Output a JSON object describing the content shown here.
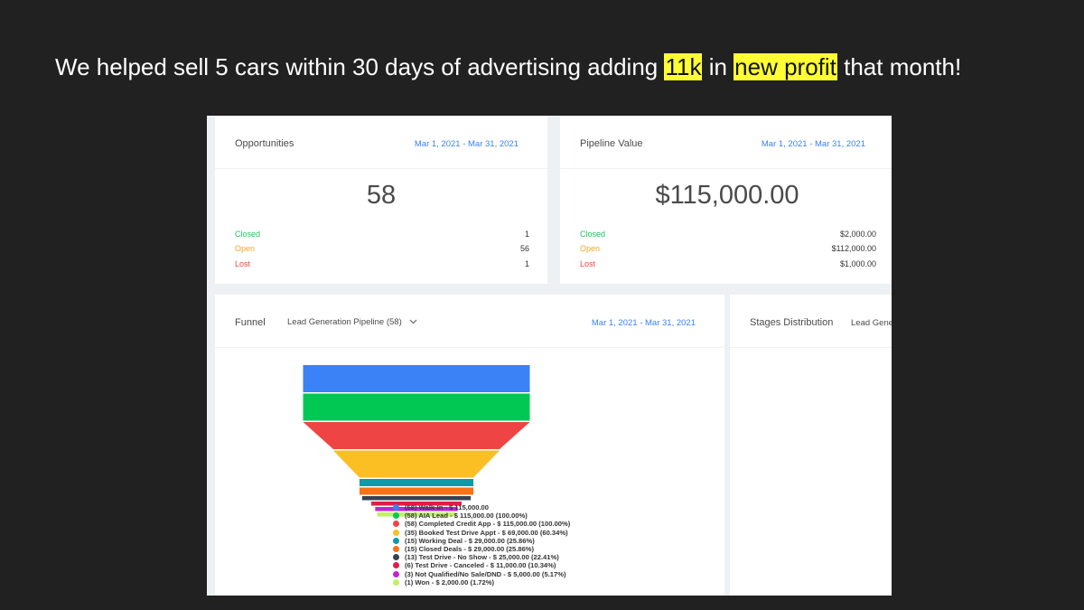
{
  "headline": {
    "part1": "We helped sell 5 cars within 30 days of advertising adding ",
    "highlight1": "11k",
    "part2": " in ",
    "highlight2": "new profit",
    "part3": " that month!"
  },
  "opportunities": {
    "title": "Opportunities",
    "date_range": "Mar 1, 2021 - Mar 31, 2021",
    "total": "58",
    "rows": [
      {
        "label": "Closed",
        "value": "1"
      },
      {
        "label": "Open",
        "value": "56"
      },
      {
        "label": "Lost",
        "value": "1"
      }
    ]
  },
  "pipeline_value": {
    "title": "Pipeline Value",
    "date_range": "Mar 1, 2021 - Mar 31, 2021",
    "total": "$115,000.00",
    "rows": [
      {
        "label": "Closed",
        "value": "$2,000.00"
      },
      {
        "label": "Open",
        "value": "$112,000.00"
      },
      {
        "label": "Lost",
        "value": "$1,000.00"
      }
    ]
  },
  "funnel": {
    "title": "Funnel",
    "pipeline_select": "Lead Generation Pipeline (58)",
    "date_range": "Mar 1, 2021 - Mar 31, 2021"
  },
  "stages": {
    "title": "Stages Distribution",
    "pipeline_select": "Lead Gene"
  },
  "chart_data": {
    "type": "funnel",
    "series": [
      {
        "name": "(58) Walk-In - $ 115,000.00",
        "value": 115000,
        "color": "#3b82f6"
      },
      {
        "name": "(58) AIA Lead - $ 115,000.00 (100.00%)",
        "value": 115000,
        "color": "#00c853"
      },
      {
        "name": "(58) Completed Credit App - $ 115,000.00 (100.00%)",
        "value": 115000,
        "color": "#ef4444"
      },
      {
        "name": "(35) Booked Test Drive Appt - $ 69,000.00 (60.34%)",
        "value": 69000,
        "color": "#fbbf24"
      },
      {
        "name": "(15) Working Deal - $ 29,000.00 (25.86%)",
        "value": 29000,
        "color": "#0e9aa7"
      },
      {
        "name": "(15) Closed Deals - $ 29,000.00 (25.86%)",
        "value": 29000,
        "color": "#f97316"
      },
      {
        "name": "(13) Test Drive - No Show - $ 25,000.00 (22.41%)",
        "value": 25000,
        "color": "#374151"
      },
      {
        "name": "(6) Test Drive - Canceled - $ 11,000.00 (10.34%)",
        "value": 11000,
        "color": "#e11d48"
      },
      {
        "name": "(3) Not Qualified/No Sale/DND - $ 5,000.00 (5.17%)",
        "value": 5000,
        "color": "#c026d3"
      },
      {
        "name": "(1) Won - $ 2,000.00 (1.72%)",
        "value": 2000,
        "color": "#bef264"
      }
    ]
  }
}
